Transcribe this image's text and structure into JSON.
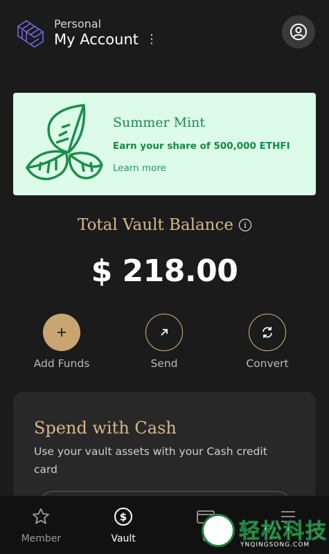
{
  "header": {
    "account_type": "Personal",
    "account_name": "My Account",
    "menu_glyph": "⋮"
  },
  "promo": {
    "title": "Summer Mint",
    "subtitle": "Earn your share of 500,000 ETHFI",
    "link": "Learn more"
  },
  "balance": {
    "label": "Total Vault Balance",
    "info_glyph": "i",
    "value": "$ 218.00"
  },
  "actions": [
    {
      "label": "Add Funds",
      "icon": "plus-icon"
    },
    {
      "label": "Send",
      "icon": "arrow-up-right-icon"
    },
    {
      "label": "Convert",
      "icon": "refresh-icon"
    }
  ],
  "card": {
    "title": "Spend with Cash",
    "description": "Use your vault assets with your Cash credit card"
  },
  "tabs": [
    {
      "label": "Member",
      "icon": "star-icon"
    },
    {
      "label": "Vault",
      "icon": "dollar-circle-icon",
      "active": true
    },
    {
      "label": "C",
      "icon": "card-icon"
    },
    {
      "label": "",
      "icon": "menu-icon"
    }
  ],
  "watermark": {
    "text": "轻松科技",
    "sub": "YNQINGSONG.COM"
  },
  "colors": {
    "background": "#1b1b1b",
    "gold": "#d6b889",
    "promo_bg": "#dcfbe8",
    "promo_green": "#1a8b4c"
  }
}
